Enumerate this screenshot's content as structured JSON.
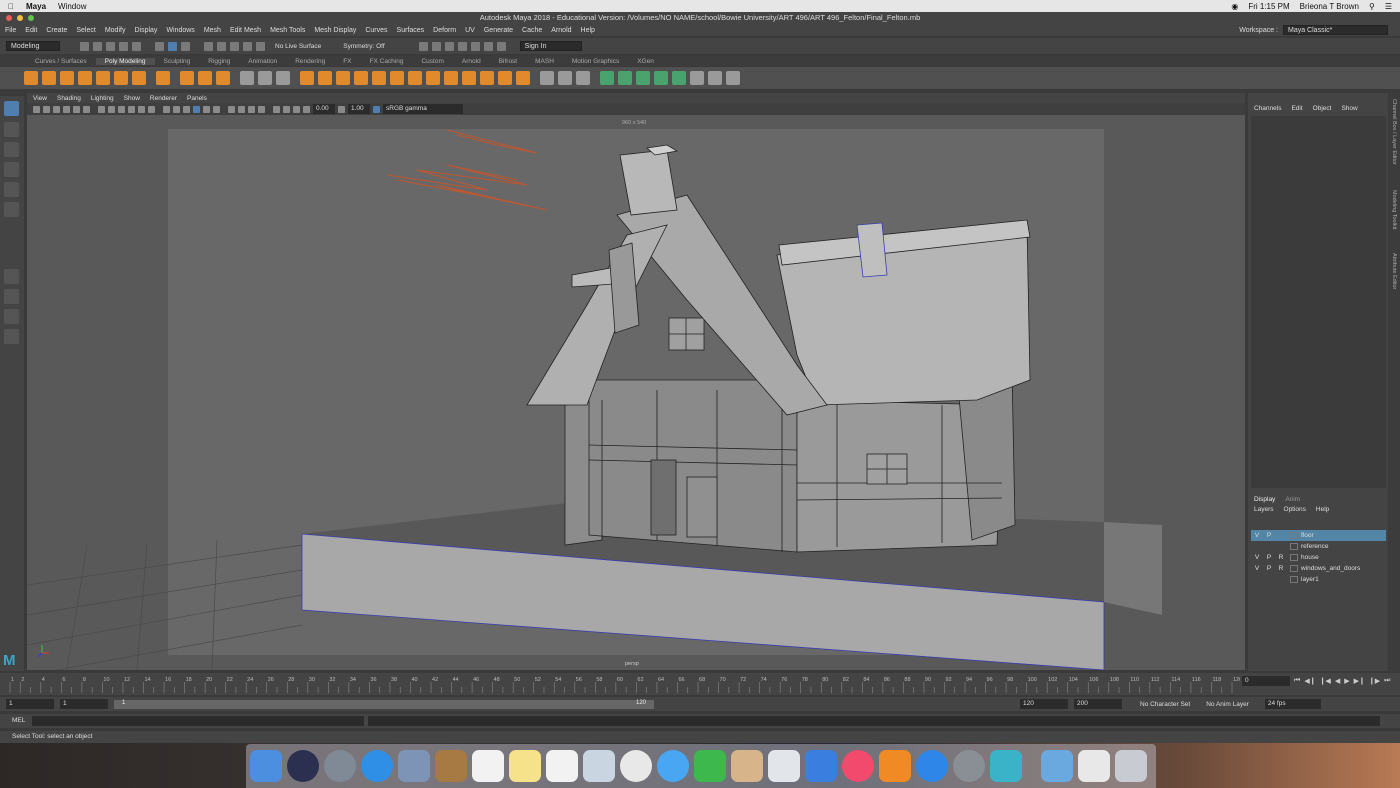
{
  "mac_menubar": {
    "app": "Maya",
    "items": [
      "Window"
    ],
    "clock": "Fri 1:15 PM",
    "user": "Brieona T Brown"
  },
  "window": {
    "title": "Autodesk Maya 2018 - Educational Version: /Volumes/NO NAME/school/Bowie University/ART 496/ART 496_Felton/Final_Felton.mb"
  },
  "menubar": {
    "items": [
      "File",
      "Edit",
      "Create",
      "Select",
      "Modify",
      "Display",
      "Windows",
      "Mesh",
      "Edit Mesh",
      "Mesh Tools",
      "Mesh Display",
      "Curves",
      "Surfaces",
      "Deform",
      "UV",
      "Generate",
      "Cache",
      "Arnold",
      "Help"
    ],
    "workspace_label": "Workspace :",
    "workspace_value": "Maya Classic*"
  },
  "statusline": {
    "mode": "Modeling",
    "live_surface": "No Live Surface",
    "symmetry": "Symmetry: Off",
    "sign_in": "Sign In"
  },
  "shelf_tabs": [
    "Curves / Surfaces",
    "Poly Modeling",
    "Sculpting",
    "Rigging",
    "Animation",
    "Rendering",
    "FX",
    "FX Caching",
    "Custom",
    "Arnold",
    "Bifrost",
    "MASH",
    "Motion Graphics",
    "XGen"
  ],
  "shelf_active": "Poly Modeling",
  "viewport": {
    "menus": [
      "View",
      "Shading",
      "Lighting",
      "Show",
      "Renderer",
      "Panels"
    ],
    "exposure": "0.00",
    "gamma": "1.00",
    "color_space": "sRGB gamma",
    "resolution": "960 x 540",
    "camera": "persp"
  },
  "channel_box": {
    "menus": [
      "Channels",
      "Edit",
      "Object",
      "Show"
    ]
  },
  "side_tabs": [
    "Channel Box / Layer Editor",
    "Modeling Toolkit",
    "Attribute Editor"
  ],
  "layers": {
    "tabs": [
      "Display",
      "Anim"
    ],
    "menus": [
      "Layers",
      "Options",
      "Help"
    ],
    "rows": [
      {
        "v": "V",
        "p": "P",
        "r": "",
        "name": "floor",
        "selected": true
      },
      {
        "v": "",
        "p": "",
        "r": "",
        "name": "reference",
        "selected": false
      },
      {
        "v": "V",
        "p": "P",
        "r": "R",
        "name": "house",
        "selected": false
      },
      {
        "v": "V",
        "p": "P",
        "r": "R",
        "name": "windows_and_doors",
        "selected": false
      },
      {
        "v": "",
        "p": "",
        "r": "",
        "name": "layer1",
        "selected": false
      }
    ]
  },
  "timeline": {
    "ticks": [
      "1",
      "2",
      "4",
      "6",
      "8",
      "10",
      "12",
      "14",
      "16",
      "18",
      "20",
      "22",
      "24",
      "26",
      "28",
      "30",
      "32",
      "34",
      "36",
      "38",
      "40",
      "42",
      "44",
      "46",
      "48",
      "50",
      "52",
      "54",
      "56",
      "58",
      "60",
      "62",
      "64",
      "66",
      "68",
      "70",
      "72",
      "74",
      "76",
      "78",
      "80",
      "82",
      "84",
      "86",
      "88",
      "90",
      "92",
      "94",
      "96",
      "98",
      "100",
      "102",
      "104",
      "106",
      "108",
      "110",
      "112",
      "114",
      "116",
      "118",
      "120"
    ],
    "current": "0"
  },
  "range": {
    "start": "1",
    "start2": "1",
    "slider_start": "1",
    "slider_end": "120",
    "end": "120",
    "end2": "200",
    "char_set": "No Character Set",
    "anim_layer": "No Anim Layer",
    "fps": "24 fps"
  },
  "cmd": {
    "label": "MEL"
  },
  "help_line": "Select Tool: select an object"
}
